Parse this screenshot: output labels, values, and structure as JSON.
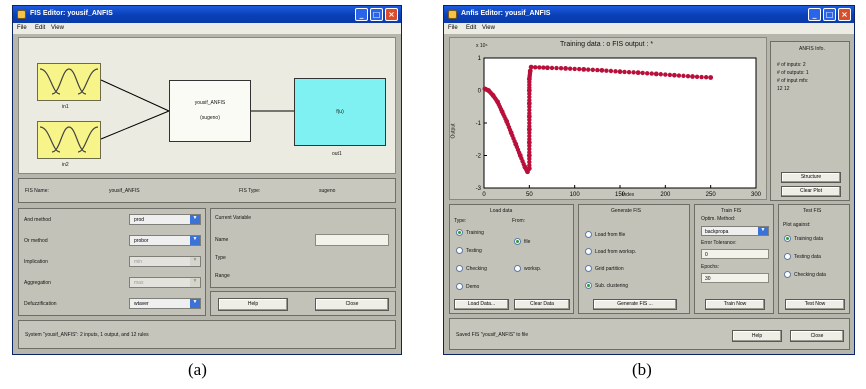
{
  "captions": {
    "a": "(a)",
    "b": "(b)"
  },
  "fis_editor": {
    "title": "FIS Editor: yousif_ANFIS",
    "menu": [
      "File",
      "Edit",
      "View"
    ],
    "diagram": {
      "inputs": [
        "in1",
        "in2"
      ],
      "system_name": "yousif_ANFIS",
      "system_type": "(sugeno)",
      "output_box_label": "f(u)",
      "output_name": "out1"
    },
    "fis_name_label": "FIS Name:",
    "fis_name_value": "yousif_ANFIS",
    "fis_type_label": "FIS Type:",
    "fis_type_value": "sugeno",
    "methods": [
      {
        "label": "And method",
        "value": "prod",
        "enabled": true
      },
      {
        "label": "Or method",
        "value": "probor",
        "enabled": true
      },
      {
        "label": "Implication",
        "value": "min",
        "enabled": false
      },
      {
        "label": "Aggregation",
        "value": "max",
        "enabled": false
      },
      {
        "label": "Defuzzification",
        "value": "wtaver",
        "enabled": true
      }
    ],
    "current_variable": {
      "title": "Current Variable",
      "name_label": "Name",
      "type_label": "Type",
      "range_label": "Range"
    },
    "help_label": "Help",
    "close_label": "Close",
    "status": "System \"yousif_ANFIS\": 2 inputs, 1 output, and 12 rules"
  },
  "anfis_editor": {
    "title": "Anfis Editor: yousif_ANFIS",
    "menu": [
      "File",
      "Edit",
      "View"
    ],
    "plot_title": "Training data : o   FIS output : *",
    "exponent": "x 10⁶",
    "ylabel": "Output",
    "xlabel": "Index",
    "info": {
      "title": "ANFIS Info.",
      "lines": [
        "# of inputs: 2",
        "# of outputs: 1",
        "# of input mfs:",
        "12 12"
      ]
    },
    "structure_label": "Structure",
    "clear_plot_label": "Clear Plot",
    "load_data": {
      "title": "Load data",
      "type_label": "Type:",
      "from_label": "From:",
      "types": [
        {
          "label": "Training",
          "on": true
        },
        {
          "label": "Testing",
          "on": false
        },
        {
          "label": "Checking",
          "on": false
        },
        {
          "label": "Demo",
          "on": false
        }
      ],
      "sources": [
        {
          "label": "file",
          "on": true
        },
        {
          "label": "worksp.",
          "on": false
        }
      ],
      "load_button": "Load Data...",
      "clear_button": "Clear Data"
    },
    "generate": {
      "title": "Generate FIS",
      "options": [
        {
          "label": "Load from file",
          "on": false
        },
        {
          "label": "Load from worksp.",
          "on": false
        },
        {
          "label": "Grid partition",
          "on": false
        },
        {
          "label": "Sub. clustering",
          "on": true
        }
      ],
      "button": "Generate FIS ..."
    },
    "train": {
      "title": "Train FIS",
      "optim_label": "Optim. Method:",
      "optim_value": "backpropa",
      "tolerance_label": "Error Tolerance:",
      "tolerance_value": "0",
      "epochs_label": "Epochs:",
      "epochs_value": "30",
      "button": "Train Now"
    },
    "test": {
      "title": "Test FIS",
      "against_label": "Plot against:",
      "options": [
        {
          "label": "Training data",
          "on": true
        },
        {
          "label": "Testing data",
          "on": false
        },
        {
          "label": "Checking data",
          "on": false
        }
      ],
      "button": "Test Now"
    },
    "status": "Saved FIS \"yousif_ANFIS\" to file",
    "help_label": "Help",
    "close_label": "Close"
  },
  "chart_data": {
    "type": "scatter",
    "title": "Training data : o   FIS output : *",
    "xlabel": "Index",
    "ylabel": "Output",
    "y_multiplier": "x 10⁶",
    "xlim": [
      0,
      300
    ],
    "ylim": [
      -3,
      1
    ],
    "xticks": [
      0,
      50,
      100,
      150,
      200,
      250,
      300
    ],
    "yticks": [
      1,
      0,
      -1,
      -2,
      -3
    ],
    "grid": false,
    "color": "#b8103a",
    "series": [
      {
        "points": [
          [
            1,
            0.05
          ],
          [
            5,
            0.0
          ],
          [
            10,
            -0.15
          ],
          [
            15,
            -0.35
          ],
          [
            20,
            -0.65
          ],
          [
            25,
            -0.95
          ],
          [
            30,
            -1.3
          ],
          [
            35,
            -1.65
          ],
          [
            40,
            -2.0
          ],
          [
            45,
            -2.35
          ],
          [
            48,
            -2.5
          ]
        ]
      },
      {
        "points": [
          [
            50,
            -2.4
          ],
          [
            50,
            -2.0
          ],
          [
            50,
            -1.6
          ],
          [
            50,
            -1.2
          ],
          [
            50,
            -0.8
          ],
          [
            50,
            -0.4
          ],
          [
            50,
            0.0
          ],
          [
            50,
            0.35
          ],
          [
            51,
            0.6
          ]
        ]
      },
      {
        "points": [
          [
            52,
            0.72
          ],
          [
            70,
            0.7
          ],
          [
            90,
            0.68
          ],
          [
            110,
            0.65
          ],
          [
            130,
            0.62
          ],
          [
            150,
            0.58
          ],
          [
            170,
            0.55
          ],
          [
            190,
            0.51
          ],
          [
            210,
            0.47
          ],
          [
            230,
            0.43
          ],
          [
            250,
            0.4
          ]
        ]
      }
    ]
  }
}
